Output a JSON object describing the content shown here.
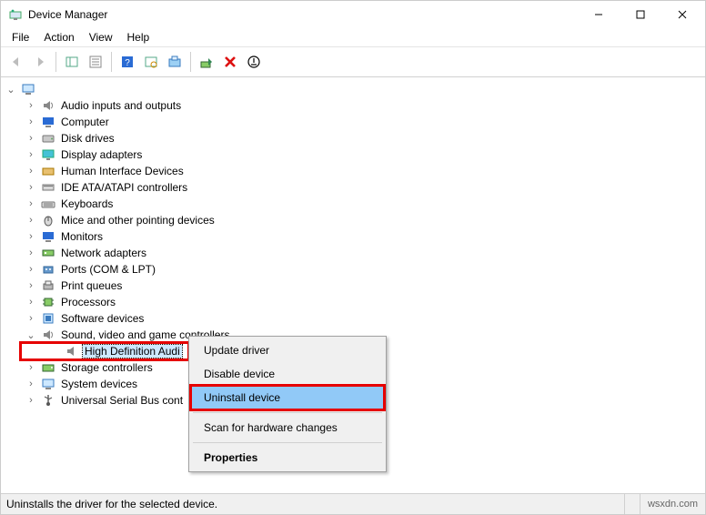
{
  "window": {
    "title": "Device Manager"
  },
  "menu": {
    "file": "File",
    "action": "Action",
    "view": "View",
    "help": "Help"
  },
  "tree": {
    "items": [
      {
        "label": "Audio inputs and outputs"
      },
      {
        "label": "Computer"
      },
      {
        "label": "Disk drives"
      },
      {
        "label": "Display adapters"
      },
      {
        "label": "Human Interface Devices"
      },
      {
        "label": "IDE ATA/ATAPI controllers"
      },
      {
        "label": "Keyboards"
      },
      {
        "label": "Mice and other pointing devices"
      },
      {
        "label": "Monitors"
      },
      {
        "label": "Network adapters"
      },
      {
        "label": "Ports (COM & LPT)"
      },
      {
        "label": "Print queues"
      },
      {
        "label": "Processors"
      },
      {
        "label": "Software devices"
      },
      {
        "label": "Sound, video and game controllers"
      },
      {
        "label": "Storage controllers"
      },
      {
        "label": "System devices"
      },
      {
        "label": "Universal Serial Bus cont"
      }
    ],
    "selected_child": "High Definition Audi"
  },
  "context_menu": {
    "update": "Update driver",
    "disable": "Disable device",
    "uninstall": "Uninstall device",
    "scan": "Scan for hardware changes",
    "properties": "Properties"
  },
  "status": {
    "text": "Uninstalls the driver for the selected device."
  },
  "watermark": "wsxdn.com"
}
